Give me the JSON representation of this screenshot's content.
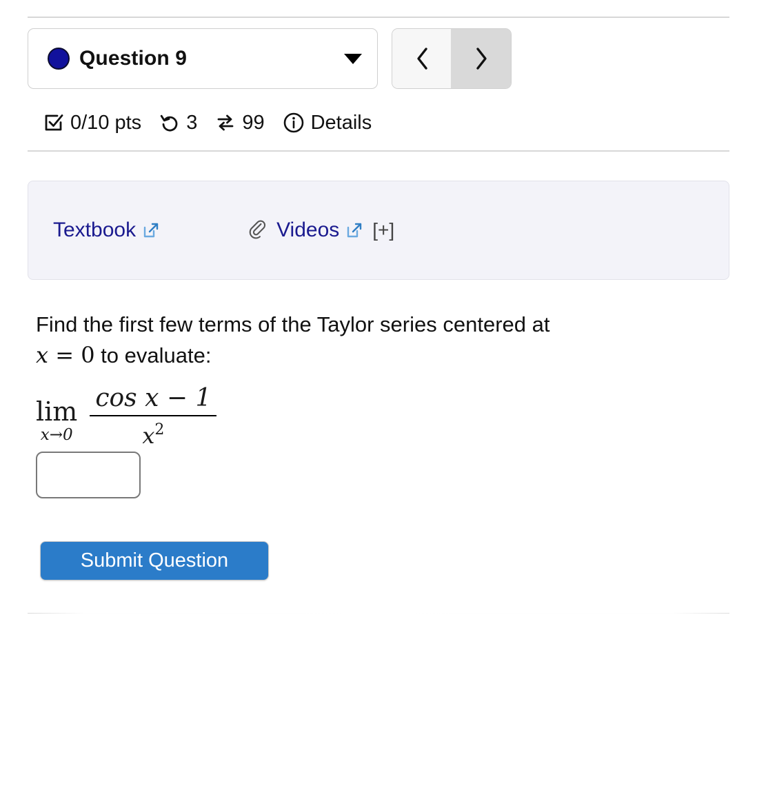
{
  "question_selector": {
    "status_color": "#11119c",
    "label": "Question 9",
    "caret_icon": "chevron-down-icon"
  },
  "navigation": {
    "prev_label": "‹",
    "next_label": "›",
    "prev_icon": "chevron-left-icon",
    "next_icon": "chevron-right-icon",
    "next_active": true
  },
  "status": {
    "score": "0/10 pts",
    "score_icon": "check-square-icon",
    "attempts": "3",
    "attempts_icon": "rotate-left-icon",
    "variations": "99",
    "variations_icon": "exchange-arrows-icon",
    "details_label": "Details",
    "details_icon": "info-circle-icon"
  },
  "resources": {
    "background_color": "#f3f3f9",
    "link_color": "#1a1a8f",
    "textbook": {
      "label": "Textbook",
      "external_icon": "external-link-icon"
    },
    "videos": {
      "attachment_icon": "paperclip-icon",
      "label": "Videos",
      "external_icon": "external-link-icon",
      "expand_label": "[+]"
    }
  },
  "question": {
    "line1": "Find the first few terms of the Taylor series centered at",
    "math_x": "x",
    "math_eq": " = 0",
    "line2_tail": " to evaluate:",
    "limit": {
      "operator": "lim",
      "subscript": "x→0",
      "numerator": "cos x − 1",
      "denominator_base": "x",
      "denominator_exponent": "2"
    }
  },
  "answer": {
    "value": "",
    "placeholder": ""
  },
  "submit": {
    "label": "Submit Question",
    "color": "#2b7cc9"
  }
}
